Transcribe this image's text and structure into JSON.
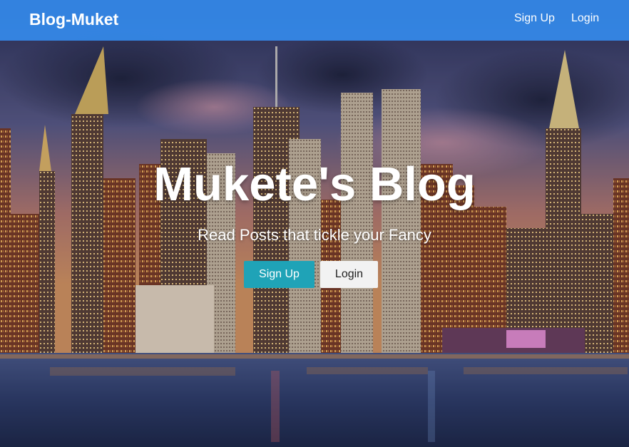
{
  "navbar": {
    "brand": "Blog-Muket",
    "links": [
      {
        "label": "Sign Up"
      },
      {
        "label": "Login"
      }
    ],
    "color": "#3489ea"
  },
  "hero": {
    "title": "Mukete's Blog",
    "subtitle": "Read Posts that tickle your Fancy",
    "background": "city skyline at dusk over water",
    "buttons": {
      "signup_label": "Sign Up",
      "login_label": "Login"
    },
    "colors": {
      "signup": "#1fa3b7",
      "login": "#f2f2f2"
    }
  }
}
